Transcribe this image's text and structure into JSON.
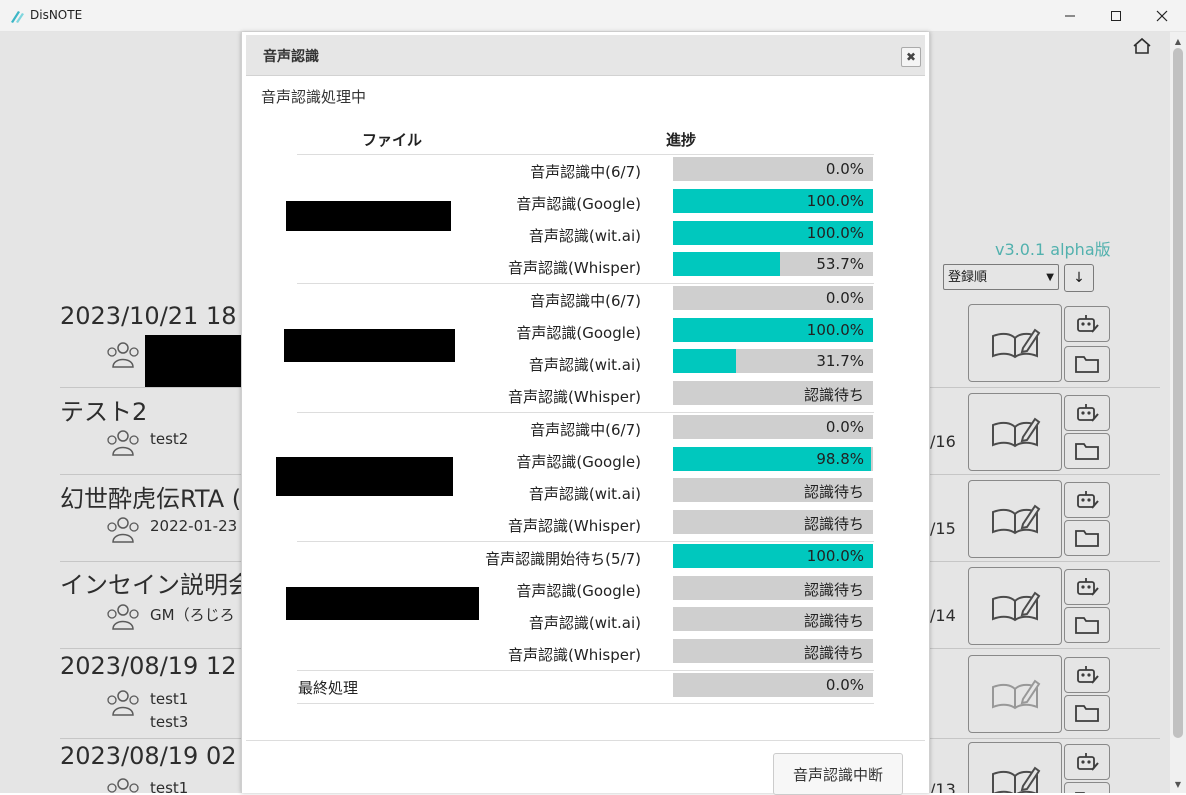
{
  "window": {
    "title": "DisNOTE",
    "minimize_icon": "minimize-icon",
    "maximize_icon": "maximize-icon",
    "close_icon": "close-icon"
  },
  "background": {
    "version": "v3.0.1 alpha版",
    "sort_select": "登録順",
    "sort_order_icon": "↓",
    "items": [
      {
        "title": "2023/10/21 18",
        "members": [
          ""
        ]
      },
      {
        "title": "テスト2",
        "members": [
          "test2"
        ],
        "date": "/16"
      },
      {
        "title": "幻世酔虎伝RTA (",
        "members": [
          "2022-01-23"
        ],
        "date": "/15"
      },
      {
        "title": "インセイン説明会",
        "members": [
          "GM（ろじろ"
        ],
        "date": "/14"
      },
      {
        "title": "2023/08/19 12",
        "members": [
          "test1",
          "test3"
        ]
      },
      {
        "title": "2023/08/19 02",
        "members": [
          "test1"
        ],
        "date": "/13"
      }
    ]
  },
  "modal": {
    "title": "音声認識",
    "status": "音声認識処理中",
    "col_file": "ファイル",
    "col_progress": "進捗",
    "groups": [
      {
        "rows": [
          {
            "label": "音声認識中(6/7)",
            "progress": 0.0,
            "text": "0.0%"
          },
          {
            "label": "音声認識(Google)",
            "progress": 1.0,
            "text": "100.0%"
          },
          {
            "label": "音声認識(wit.ai)",
            "progress": 1.0,
            "text": "100.0%"
          },
          {
            "label": "音声認識(Whisper)",
            "progress": 0.537,
            "text": "53.7%"
          }
        ]
      },
      {
        "rows": [
          {
            "label": "音声認識中(6/7)",
            "progress": 0.0,
            "text": "0.0%"
          },
          {
            "label": "音声認識(Google)",
            "progress": 1.0,
            "text": "100.0%"
          },
          {
            "label": "音声認識(wit.ai)",
            "progress": 0.317,
            "text": "31.7%"
          },
          {
            "label": "音声認識(Whisper)",
            "progress": 0.0,
            "text": "認識待ち"
          }
        ]
      },
      {
        "rows": [
          {
            "label": "音声認識中(6/7)",
            "progress": 0.0,
            "text": "0.0%"
          },
          {
            "label": "音声認識(Google)",
            "progress": 0.988,
            "text": "98.8%"
          },
          {
            "label": "音声認識(wit.ai)",
            "progress": 0.0,
            "text": "認識待ち"
          },
          {
            "label": "音声認識(Whisper)",
            "progress": 0.0,
            "text": "認識待ち"
          }
        ]
      },
      {
        "rows": [
          {
            "label": "音声認識開始待ち(5/7)",
            "progress": 1.0,
            "text": "100.0%"
          },
          {
            "label": "音声認識(Google)",
            "progress": 0.0,
            "text": "認識待ち"
          },
          {
            "label": "音声認識(wit.ai)",
            "progress": 0.0,
            "text": "認識待ち"
          },
          {
            "label": "音声認識(Whisper)",
            "progress": 0.0,
            "text": "認識待ち"
          }
        ]
      }
    ],
    "final": {
      "label": "最終処理",
      "progress": 0.0,
      "text": "0.0%"
    },
    "stop_button": "音声認識中断"
  },
  "colors": {
    "accent": "#00c8be",
    "bar_bg": "#cfcfcf",
    "version_color": "#5cc6c2"
  }
}
